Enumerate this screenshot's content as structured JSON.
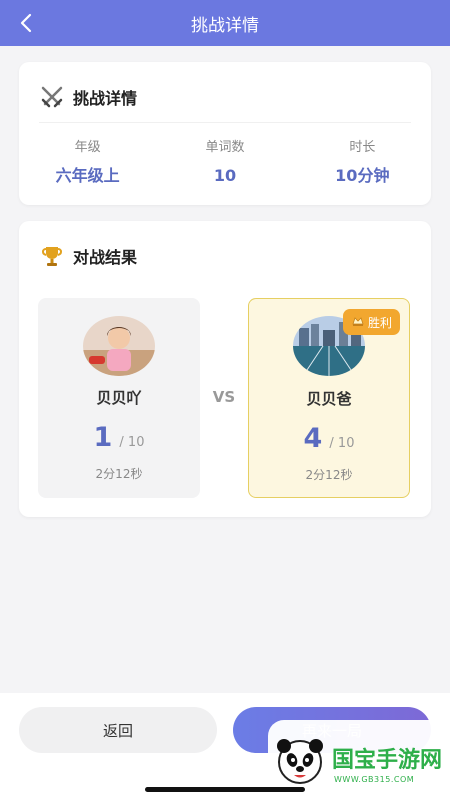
{
  "header": {
    "title": "挑战详情"
  },
  "details": {
    "title": "挑战详情",
    "stats": [
      {
        "label": "年级",
        "value": "六年级上"
      },
      {
        "label": "单词数",
        "value": "10"
      },
      {
        "label": "时长",
        "value": "10分钟"
      }
    ]
  },
  "result": {
    "title": "对战结果",
    "vs": "VS",
    "left": {
      "name": "贝贝吖",
      "score": "1",
      "total": "/ 10",
      "time": "2分12秒"
    },
    "right": {
      "name": "贝贝爸",
      "score": "4",
      "total": "/ 10",
      "time": "2分12秒",
      "badge": "胜利"
    }
  },
  "buttons": {
    "return": "返回",
    "again": "再来一局"
  },
  "watermark": {
    "text": "国宝手游网",
    "url": "WWW.GB315.COM"
  },
  "colors": {
    "accent": "#6b78e0",
    "score": "#5a6bc0",
    "winner_border": "#e6cf62",
    "badge": "#f2a72f"
  }
}
